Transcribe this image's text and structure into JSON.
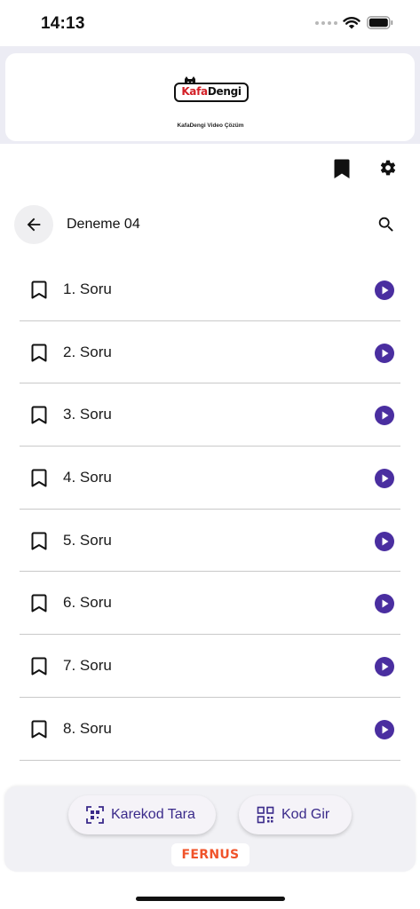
{
  "status_bar": {
    "time": "14:13"
  },
  "banner": {
    "logo_kafa": "Kafa",
    "logo_dengi": "Dengi",
    "caption": "KafaDengi Video Çözüm"
  },
  "header": {
    "title": "Deneme 04"
  },
  "questions": [
    {
      "label": "1. Soru"
    },
    {
      "label": "2. Soru"
    },
    {
      "label": "3. Soru"
    },
    {
      "label": "4. Soru"
    },
    {
      "label": "5. Soru"
    },
    {
      "label": "6. Soru"
    },
    {
      "label": "7. Soru"
    },
    {
      "label": "8. Soru"
    }
  ],
  "bottom": {
    "scan_label": "Karekod Tara",
    "code_label": "Kod Gir",
    "brand": "FERNUS"
  },
  "colors": {
    "accent": "#4a2ea0",
    "brand": "#f0532a"
  },
  "icons": [
    "wifi-icon",
    "battery-icon",
    "bookmark-icon",
    "gear-icon",
    "back-arrow-icon",
    "search-icon",
    "play-icon",
    "qr-scan-icon",
    "qr-code-icon"
  ]
}
